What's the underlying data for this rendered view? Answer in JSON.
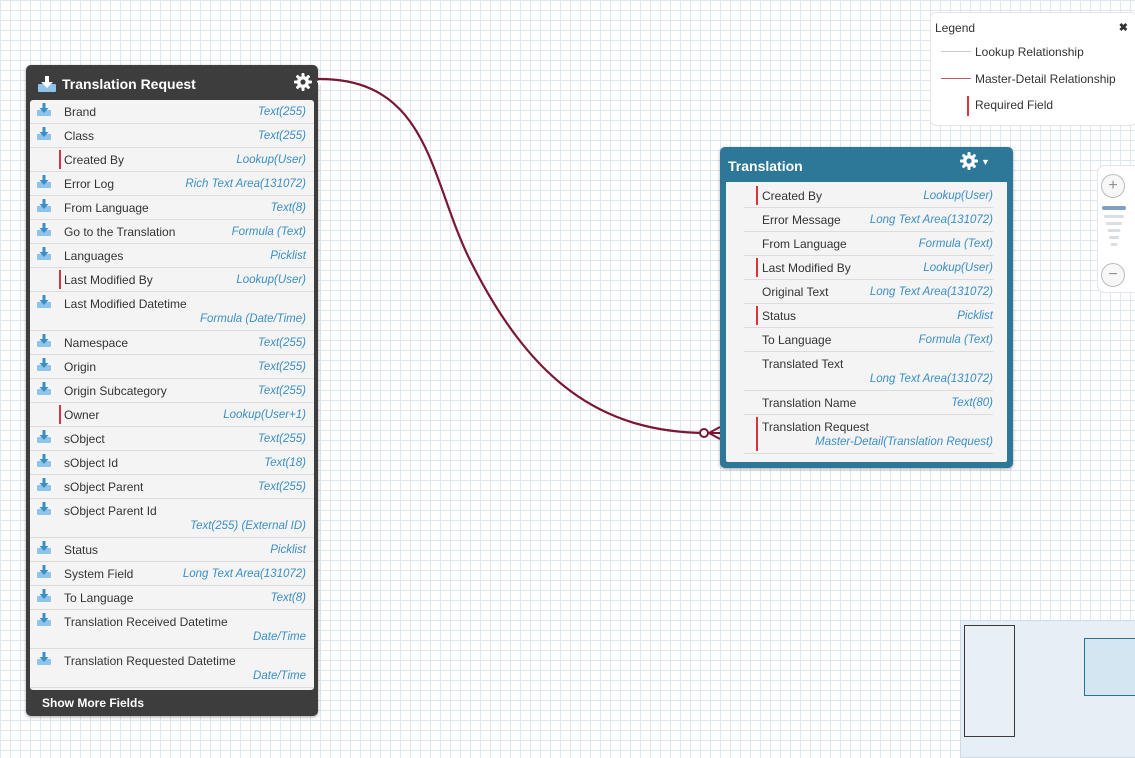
{
  "colors": {
    "translation_request_header": "#3d3d3d",
    "translation_header": "#2d7899",
    "lookup_line": "#c8cdd1",
    "master_detail_line": "#7a1734",
    "required_marker": "#d9343e",
    "field_type": "#3a8fc6"
  },
  "icons": {
    "object_icon": "download-icon",
    "field_icon": "download-icon",
    "menu_icon": "gear-icon",
    "menu_caret": "caret-down-icon",
    "legend_close": "close-icon",
    "zoom_in": "plus-icon",
    "zoom_out": "minus-icon"
  },
  "translation_request": {
    "title": "Translation Request",
    "show_more_label": "Show More Fields",
    "fields": [
      {
        "name": "Brand",
        "type": "Text(255)",
        "required": false
      },
      {
        "name": "Class",
        "type": "Text(255)",
        "required": false
      },
      {
        "name": "Created By",
        "type": "Lookup(User)",
        "required": true
      },
      {
        "name": "Error Log",
        "type": "Rich Text Area(131072)",
        "required": false
      },
      {
        "name": "From Language",
        "type": "Text(8)",
        "required": false
      },
      {
        "name": "Go to the Translation",
        "type": "Formula (Text)",
        "required": false
      },
      {
        "name": "Languages",
        "type": "Picklist",
        "required": false
      },
      {
        "name": "Last Modified By",
        "type": "Lookup(User)",
        "required": true
      },
      {
        "name": "Last Modified Datetime",
        "type": "Formula (Date/Time)",
        "required": false,
        "wrap": true
      },
      {
        "name": "Namespace",
        "type": "Text(255)",
        "required": false
      },
      {
        "name": "Origin",
        "type": "Text(255)",
        "required": false
      },
      {
        "name": "Origin Subcategory",
        "type": "Text(255)",
        "required": false
      },
      {
        "name": "Owner",
        "type": "Lookup(User+1)",
        "required": true
      },
      {
        "name": "sObject",
        "type": "Text(255)",
        "required": false
      },
      {
        "name": "sObject Id",
        "type": "Text(18)",
        "required": false
      },
      {
        "name": "sObject Parent",
        "type": "Text(255)",
        "required": false
      },
      {
        "name": "sObject Parent Id",
        "type": "Text(255) (External ID)",
        "required": false,
        "wrap": true
      },
      {
        "name": "Status",
        "type": "Picklist",
        "required": false
      },
      {
        "name": "System Field",
        "type": "Long Text Area(131072)",
        "required": false
      },
      {
        "name": "To Language",
        "type": "Text(8)",
        "required": false
      },
      {
        "name": "Translation Received Datetime",
        "type": "Date/Time",
        "required": false,
        "wrap": true
      },
      {
        "name": "Translation Requested Datetime",
        "type": "Date/Time",
        "required": false,
        "wrap": true
      }
    ]
  },
  "translation": {
    "title": "Translation",
    "fields": [
      {
        "name": "Created By",
        "type": "Lookup(User)",
        "required": true
      },
      {
        "name": "Error Message",
        "type": "Long Text Area(131072)",
        "required": false
      },
      {
        "name": "From Language",
        "type": "Formula (Text)",
        "required": false
      },
      {
        "name": "Last Modified By",
        "type": "Lookup(User)",
        "required": true
      },
      {
        "name": "Original Text",
        "type": "Long Text Area(131072)",
        "required": false
      },
      {
        "name": "Status",
        "type": "Picklist",
        "required": true
      },
      {
        "name": "To Language",
        "type": "Formula (Text)",
        "required": false
      },
      {
        "name": "Translated Text",
        "type": "Long Text Area(131072)",
        "required": false,
        "wrap": true
      },
      {
        "name": "Translation Name",
        "type": "Text(80)",
        "required": false
      },
      {
        "name": "Translation Request",
        "type": "Master-Detail(Translation Request)",
        "required": true,
        "wrap": true
      }
    ]
  },
  "legend": {
    "title": "Legend",
    "close_label": "✖",
    "items": [
      {
        "kind": "lookup",
        "label": "Lookup Relationship"
      },
      {
        "kind": "master-detail",
        "label": "Master-Detail Relationship"
      },
      {
        "kind": "required",
        "label": "Required Field"
      }
    ]
  },
  "zoom": {
    "in_label": "+",
    "out_label": "−",
    "level_fraction": 0.2
  }
}
